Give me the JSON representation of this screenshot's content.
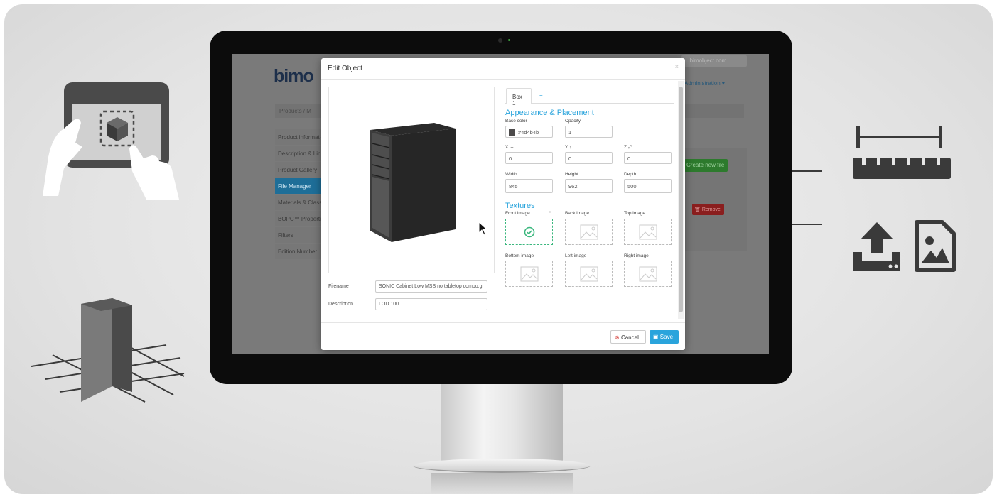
{
  "background_app": {
    "logo": "bimo",
    "top_field": "...bimobject.com",
    "admin_menu": "Administration ▾",
    "breadcrumb": "Products / M",
    "menu_items": [
      {
        "label": "Product information",
        "active": false
      },
      {
        "label": "Description & Links",
        "active": false
      },
      {
        "label": "Product Gallery",
        "active": false
      },
      {
        "label": "File Manager",
        "active": true
      },
      {
        "label": "Materials & Classification",
        "active": false
      },
      {
        "label": "BOPC™ Properties",
        "active": false
      },
      {
        "label": "Filters",
        "active": false
      },
      {
        "label": "Edition Number",
        "active": false
      }
    ],
    "create_new_file": "Create new file",
    "remove_button": "🗑 Remove"
  },
  "modal": {
    "title": "Edit Object",
    "close": "×",
    "filename_label": "Filename",
    "filename_value": "SONIC Cabinet Low MSS no tabletop combo.g",
    "description_label": "Description",
    "description_value": "LOD 100",
    "tabs": [
      {
        "label": "Box 1"
      }
    ],
    "add_tab": "+",
    "appearance_title": "Appearance & Placement",
    "base_color_label": "Base color",
    "base_color_value": "#4d4b4b",
    "opacity_label": "Opacity",
    "opacity_value": "1",
    "x_label": "X ↔",
    "x_value": "0",
    "y_label": "Y ↕",
    "y_value": "0",
    "z_label": "Z ⤢",
    "z_value": "0",
    "width_label": "Width",
    "width_value": "845",
    "height_label": "Height",
    "height_value": "962",
    "depth_label": "Depth",
    "depth_value": "500",
    "textures_title": "Textures",
    "textures": [
      {
        "label": "Front image",
        "uploaded": true
      },
      {
        "label": "Back image",
        "uploaded": false
      },
      {
        "label": "Top image",
        "uploaded": false
      },
      {
        "label": "Bottom image",
        "uploaded": false
      },
      {
        "label": "Left image",
        "uploaded": false
      },
      {
        "label": "Right image",
        "uploaded": false
      }
    ],
    "remove_texture": "×",
    "cancel_label": "Cancel",
    "save_label": "Save"
  },
  "colors": {
    "accent": "#2aa4dc",
    "success": "#3bb77e",
    "danger": "#d9534f",
    "base_color": "#4d4b4b",
    "pictogram": "#3a3a3a"
  },
  "icons": [
    "tablet-touch-icon",
    "3d-box-grid-icon",
    "ruler-icon",
    "upload-icon",
    "image-file-icon",
    "check-circle-icon",
    "mouse-cursor-icon"
  ]
}
